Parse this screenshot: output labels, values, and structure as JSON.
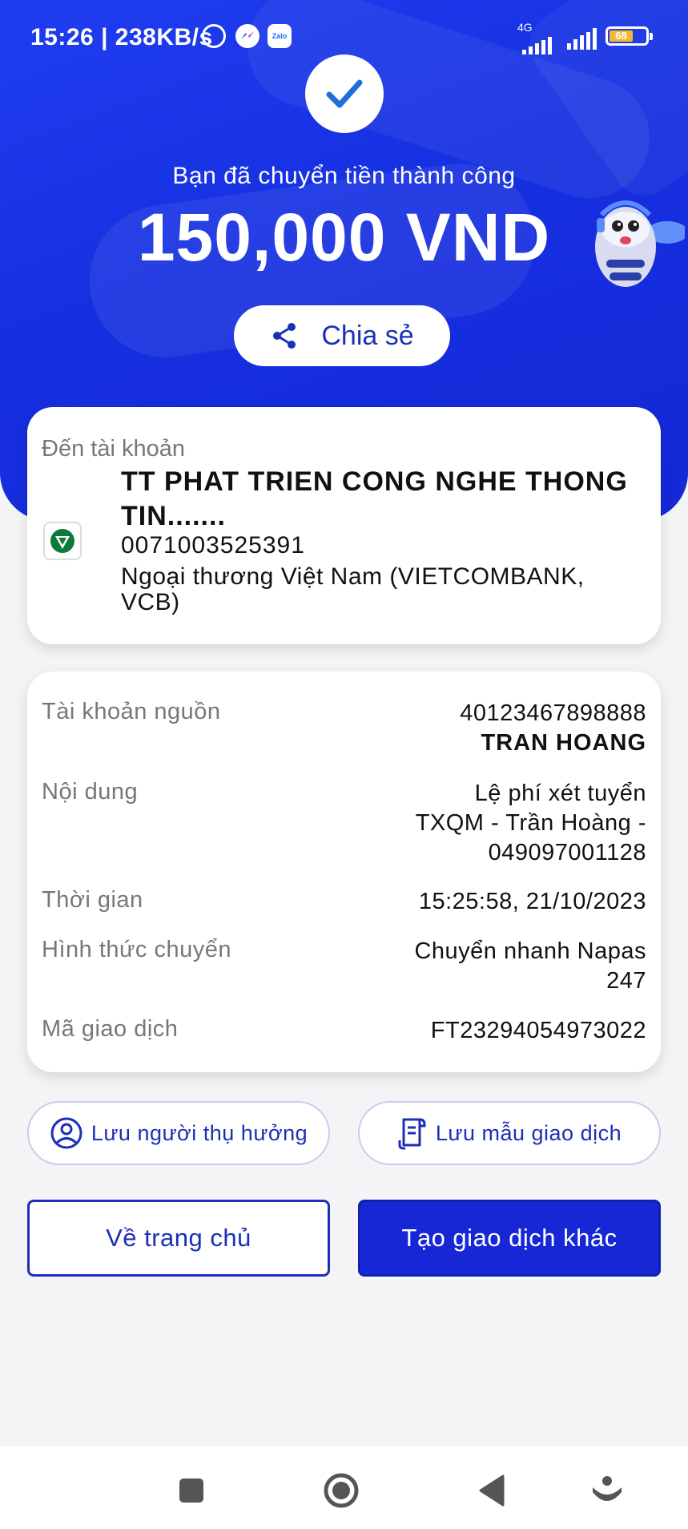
{
  "status_bar": {
    "time_speed": "15:26 | 238KB/s",
    "network_label": "4G",
    "battery_level": "68"
  },
  "hero": {
    "success_message": "Bạn đã chuyển tiền thành công",
    "amount": "150,000 VND",
    "share_label": "Chia sẻ"
  },
  "destination": {
    "label": "Đến tài khoản",
    "name": "TT PHAT TRIEN CONG NGHE THONG TIN.......",
    "account_number": "0071003525391",
    "bank_name": "Ngoại thương Việt Nam (VIETCOMBANK, VCB)"
  },
  "details": {
    "source_label": "Tài khoản nguồn",
    "source_account": "40123467898888",
    "source_name": "TRAN HOANG",
    "content_label": "Nội dung",
    "content_line1": "Lệ phí xét tuyển",
    "content_line2": "TXQM - Trần Hoàng -",
    "content_line3": "049097001128",
    "time_label": "Thời gian",
    "time_value": "15:25:58, 21/10/2023",
    "method_label": "Hình thức chuyển",
    "method_line1": "Chuyển nhanh Napas",
    "method_line2": "247",
    "txn_label": "Mã giao dịch",
    "txn_value": "FT23294054973022"
  },
  "actions": {
    "save_beneficiary": "Lưu người thụ hưởng",
    "save_template": "Lưu mẫu giao dịch",
    "home": "Về trang chủ",
    "new_transaction": "Tạo giao dịch khác"
  },
  "colors": {
    "primary": "#1727d6",
    "hero_blue": "#1f3df0",
    "text_muted": "#777777",
    "battery": "#f5b733"
  },
  "icons": {
    "check": "check-icon",
    "share": "share-icon",
    "bank": "vietcombank-logo-icon",
    "user": "user-circle-icon",
    "template": "receipt-icon",
    "nav": [
      "square-icon",
      "home-circle-icon",
      "back-triangle-icon",
      "assistant-icon"
    ]
  }
}
